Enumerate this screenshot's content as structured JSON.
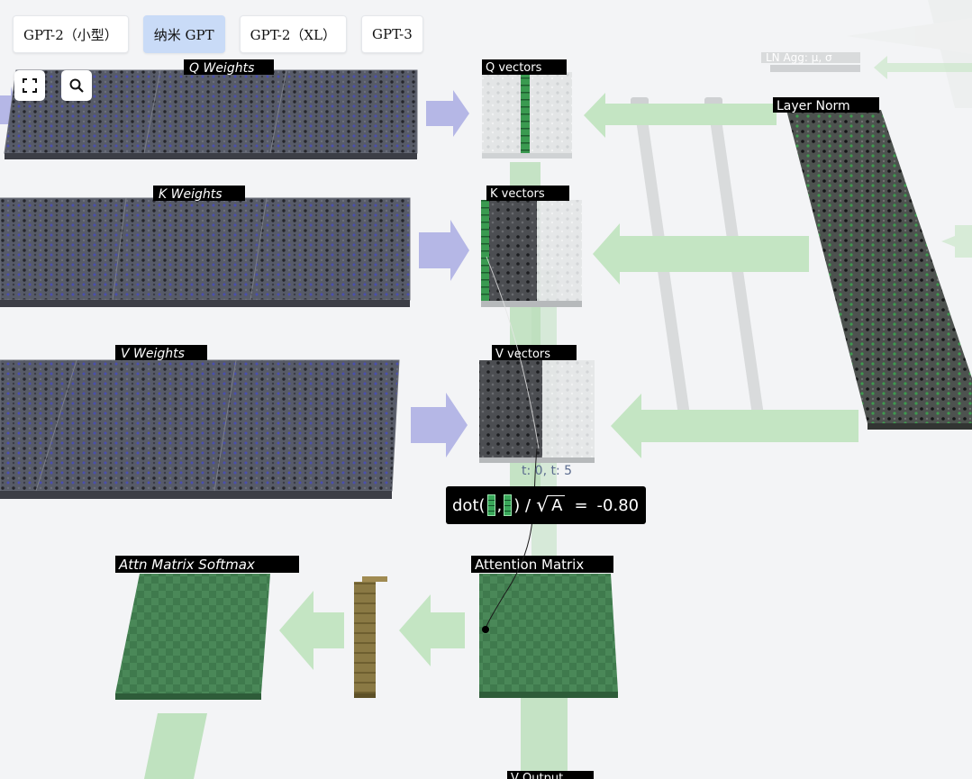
{
  "model_buttons": [
    {
      "label": "GPT-2（小型）",
      "active": false
    },
    {
      "label": "纳米 GPT",
      "active": true
    },
    {
      "label": "GPT-2（XL）",
      "active": false
    },
    {
      "label": "GPT-3",
      "active": false
    }
  ],
  "toolbar": {
    "fullscreen_icon": "fullscreen-icon",
    "search_icon": "search-icon"
  },
  "labels": {
    "q_weights": "Q Weights",
    "k_weights": "K Weights",
    "v_weights": "V Weights",
    "q_vectors": "Q vectors",
    "k_vectors": "K vectors",
    "v_vectors": "V vectors",
    "layer_norm": "Layer Norm",
    "ln_agg": "LN Agg: μ, σ",
    "attention_matrix": "Attention Matrix",
    "attn_softmax": "Attn Matrix Softmax",
    "v_output": "V Output"
  },
  "tooltip": {
    "sub": "t: 0, t: 5",
    "prefix": "dot(",
    "sep": ",",
    "mid": ") /",
    "sqrt_symbol": "√",
    "sqrt_arg": "A",
    "equals": "=",
    "value": "-0.80"
  },
  "colors": {
    "background": "#f3f4f6",
    "weights_block": "#575b68",
    "arrow_purple": "#b5b7e6",
    "arrow_green": "#c4e5c3",
    "attention_green": "#3d7a4c",
    "active_button": "#c9dbf7"
  }
}
